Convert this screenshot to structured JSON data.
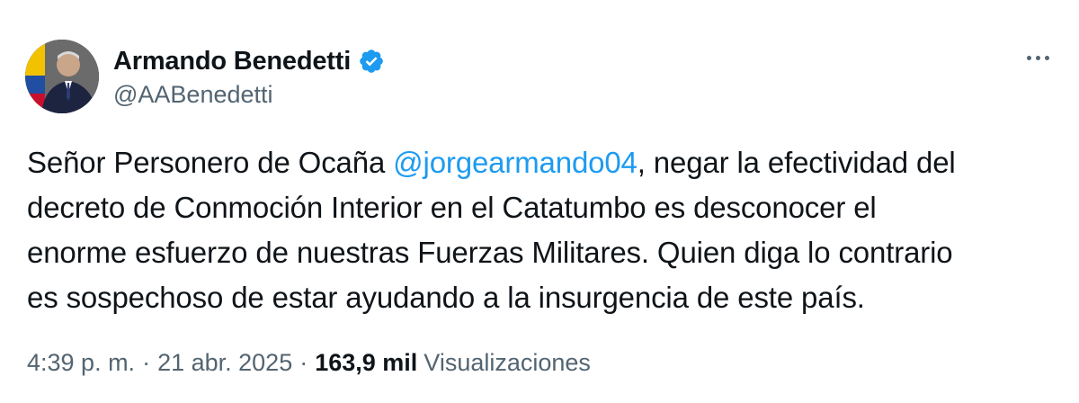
{
  "author": {
    "display_name": "Armando Benedetti",
    "handle": "@AABenedetti",
    "verified": true
  },
  "tweet": {
    "lines": [
      {
        "before": "Señor Personero de Ocaña ",
        "mention": "@jorgearmando04",
        "after": ", negar la efectividad del"
      },
      {
        "text": "decreto de Conmoción Interior en el Catatumbo es desconocer el"
      },
      {
        "text": "enorme esfuerzo de nuestras Fuerzas Militares. Quien diga lo contrario"
      },
      {
        "text": "es sospechoso de estar ayudando a la insurgencia de este país."
      }
    ]
  },
  "meta": {
    "time": "4:39 p. m.",
    "separator": "·",
    "date": "21 abr. 2025",
    "views_count": "163,9 mil",
    "views_label": "Visualizaciones"
  },
  "colors": {
    "accent": "#1d9bf0",
    "text_primary": "#0f1419",
    "text_secondary": "#536471"
  },
  "icons": {
    "verified": "verified-badge-icon",
    "more": "more-options-icon"
  }
}
